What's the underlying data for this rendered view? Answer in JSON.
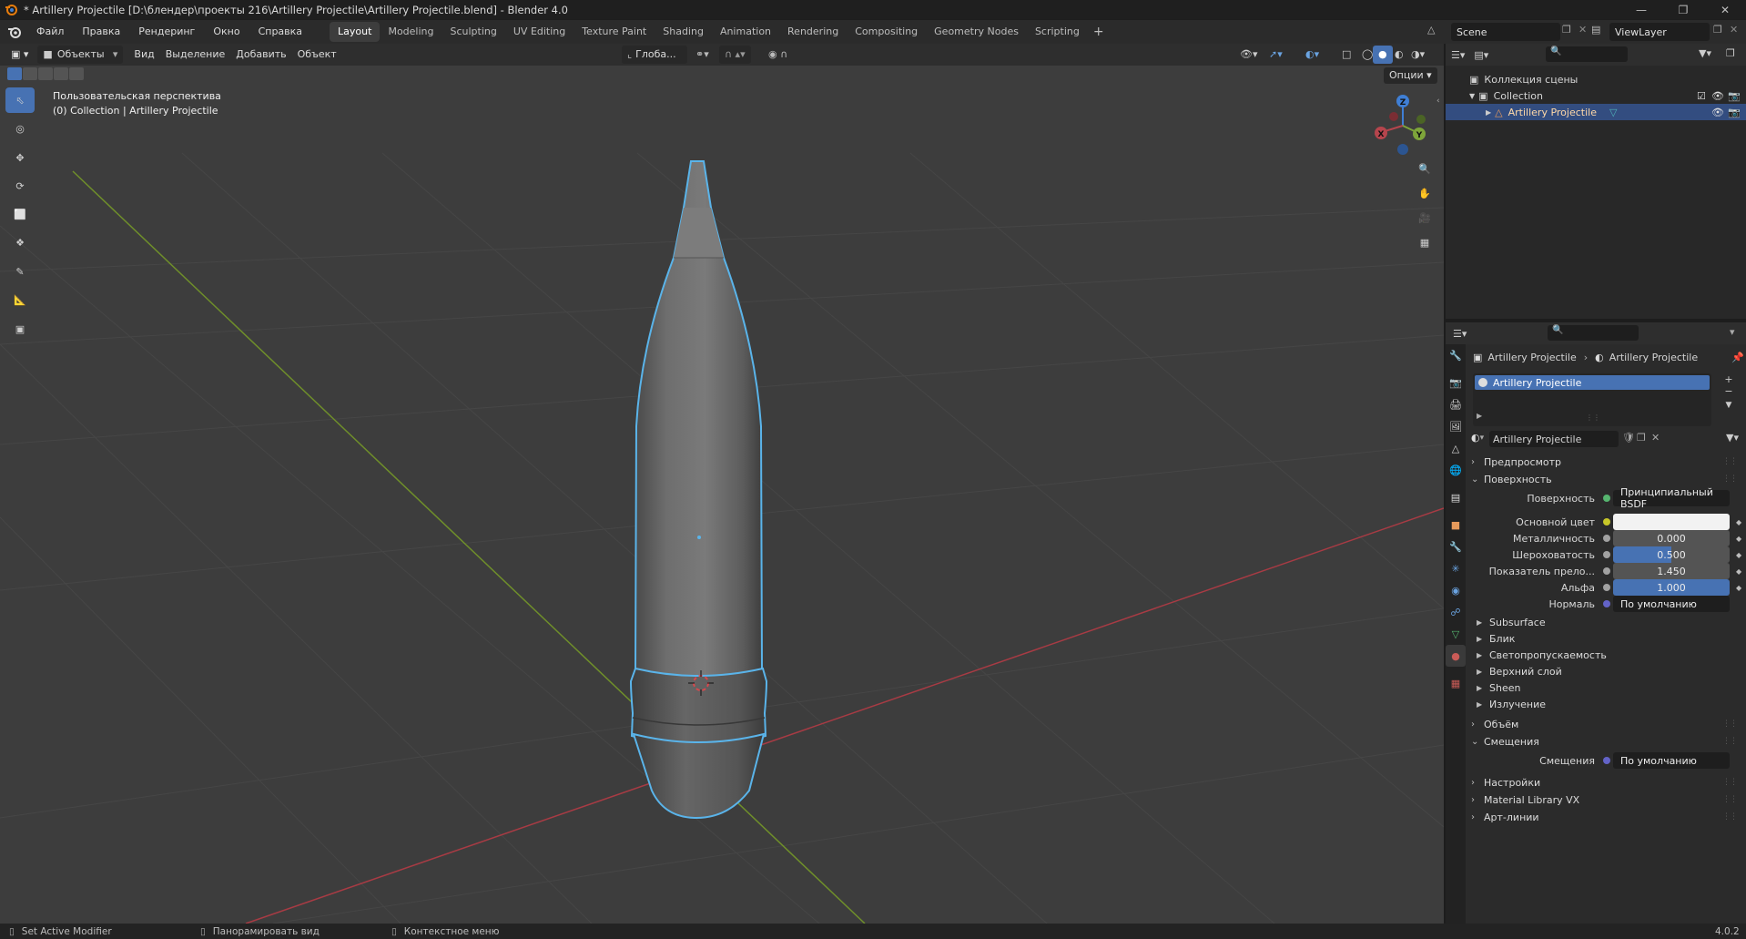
{
  "window": {
    "title": "* Artillery Projectile [D:\\блендер\\проекты 216\\Artillery Projectile\\Artillery Projectile.blend] - Blender 4.0"
  },
  "menu": {
    "items": [
      "Файл",
      "Правка",
      "Рендеринг",
      "Окно",
      "Справка"
    ]
  },
  "workspaces": [
    "Layout",
    "Modeling",
    "Sculpting",
    "UV Editing",
    "Texture Paint",
    "Shading",
    "Animation",
    "Rendering",
    "Compositing",
    "Geometry Nodes",
    "Scripting"
  ],
  "active_workspace": "Layout",
  "scene": {
    "name": "Scene",
    "view_layer": "ViewLayer"
  },
  "viewport": {
    "mode": "Объекты",
    "menus": [
      "Вид",
      "Выделение",
      "Добавить",
      "Объект"
    ],
    "transform_orientation": "Глоба...",
    "options_label": "Опции",
    "overlay_line1": "Пользовательская перспектива",
    "overlay_line2": "(0) Collection | Artillery Projectile",
    "gizmo_axes": {
      "x": "X",
      "y": "Y",
      "z": "Z"
    }
  },
  "outliner": {
    "root": "Коллекция сцены",
    "collection": "Collection",
    "object": "Artillery Projectile"
  },
  "properties": {
    "breadcrumb_object": "Artillery Projectile",
    "breadcrumb_material": "Artillery Projectile",
    "slot_name": "Artillery Projectile",
    "material_name": "Artillery Projectile",
    "sections": {
      "preview": "Предпросмотр",
      "surface": "Поверхность",
      "volume": "Объём",
      "displacement": "Смещения",
      "settings": "Настройки",
      "library": "Material Library VX",
      "lineart": "Арт-линии"
    },
    "surface_shader_label": "Поверхность",
    "surface_shader_value": "Принципиальный BSDF",
    "fields": [
      {
        "label": "Основной цвет",
        "value": "",
        "style": "white"
      },
      {
        "label": "Металличность",
        "value": "0.000",
        "style": "gray",
        "fraction": 0.0
      },
      {
        "label": "Шероховатость",
        "value": "0.500",
        "style": "blue",
        "fraction": 0.5
      },
      {
        "label": "Показатель прело...",
        "value": "1.450",
        "style": "gray"
      },
      {
        "label": "Альфа",
        "value": "1.000",
        "style": "blue",
        "fraction": 1.0
      },
      {
        "label": "Нормаль",
        "value": "По умолчанию",
        "style": "dark"
      }
    ],
    "subpanels": [
      "Subsurface",
      "Блик",
      "Светопропускаемость",
      "Верхний слой",
      "Sheen",
      "Излучение"
    ],
    "displacement_label": "Смещения",
    "displacement_value": "По умолчанию"
  },
  "statusbar": {
    "left": "Set Active Modifier",
    "middle": "Панорамировать вид",
    "right": "Контекстное меню",
    "version": "4.0.2"
  },
  "colors": {
    "accent": "#4772b3",
    "selection_outline": "#5ab4ea",
    "x_axis": "#b6454d",
    "y_axis": "#7ea53a",
    "z_axis": "#3f7fd5"
  }
}
